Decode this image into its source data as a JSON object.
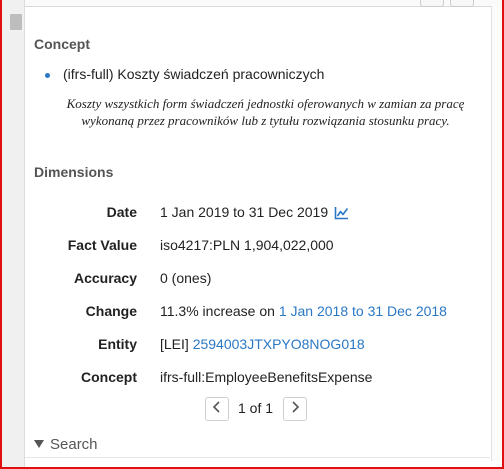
{
  "concept": {
    "heading": "Concept",
    "name": "(ifrs-full) Koszty świadczeń pracowniczych",
    "description": "Koszty wszystkich form świadczeń jednostki oferowanych w zamian za pracę wykonaną przez pracowników lub z tytułu rozwiązania stosunku pracy."
  },
  "dimensions": {
    "heading": "Dimensions",
    "date": {
      "label": "Date",
      "value": "1 Jan 2019 to 31 Dec 2019",
      "icon": "line-chart-icon"
    },
    "fact_value": {
      "label": "Fact Value",
      "value": "iso4217:PLN 1,904,022,000"
    },
    "accuracy": {
      "label": "Accuracy",
      "value": "0 (ones)"
    },
    "change": {
      "label": "Change",
      "value": "11.3% increase on ",
      "link": "1 Jan 2018 to 31 Dec 2018"
    },
    "entity": {
      "label": "Entity",
      "scheme": "[LEI] ",
      "link": "2594003JTXPYO8NOG018"
    },
    "concept": {
      "label": "Concept",
      "value": "ifrs-full:EmployeeBenefitsExpense"
    }
  },
  "pager": {
    "text": "1 of 1",
    "prev_icon": "chevron-left-icon",
    "next_icon": "chevron-right-icon"
  },
  "search": {
    "label": "Search"
  },
  "colors": {
    "accent": "#2a78c4",
    "frame": "#e01010"
  }
}
